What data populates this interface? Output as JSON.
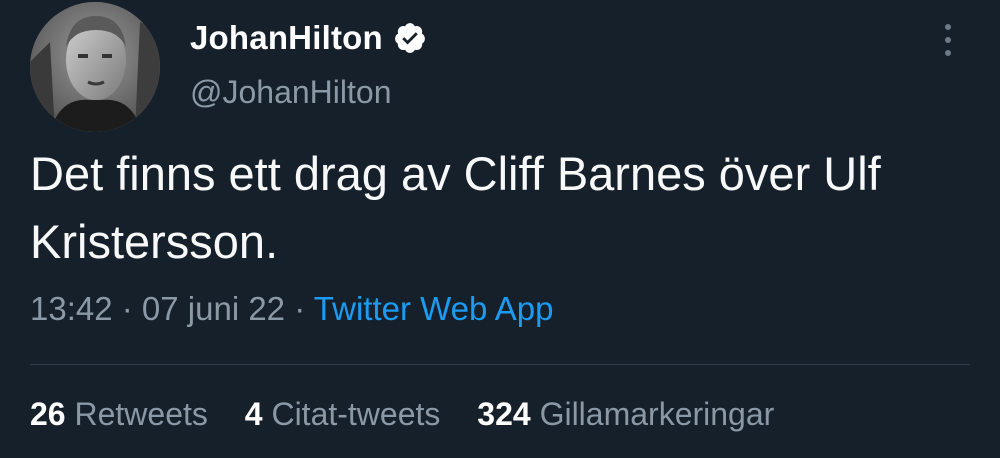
{
  "user": {
    "display_name": "JohanHilton",
    "handle": "@JohanHilton",
    "verified": true,
    "verified_color": "#ffffff",
    "avatar_icon": "profile-photo"
  },
  "tweet": {
    "text": "Det finns ett drag av Cliff Barnes över Ulf Kristersson."
  },
  "meta": {
    "time": "13:42",
    "separator1": " · ",
    "date": "07 juni 22",
    "separator2": " · ",
    "app": "Twitter Web App"
  },
  "stats": {
    "retweets_count": "26",
    "retweets_label": " Retweets",
    "quotes_count": "4",
    "quotes_label": " Citat-tweets",
    "likes_count": "324",
    "likes_label": " Gillamarkeringar"
  },
  "colors": {
    "background": "#16202b",
    "secondary_text": "#8b98a5",
    "link": "#1d9bf0",
    "divider": "#2f3b47"
  }
}
